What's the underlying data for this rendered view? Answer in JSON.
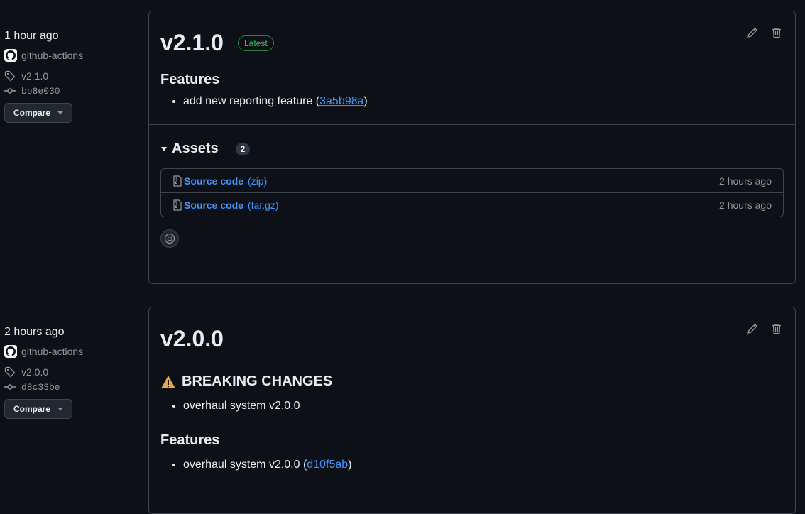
{
  "releases": [
    {
      "time": "1 hour ago",
      "author": "github-actions",
      "tag": "v2.1.0",
      "commit": "bb8e030",
      "compare_label": "Compare",
      "title": "v2.1.0",
      "badge": "Latest",
      "sections": [
        {
          "heading": "Features",
          "items": [
            {
              "text": "add new reporting feature (",
              "link": "3a5b98a",
              "suffix": ")"
            }
          ]
        }
      ],
      "assets": {
        "label": "Assets",
        "count": "2",
        "items": [
          {
            "name": "Source code",
            "ext": "(zip)",
            "time": "2 hours ago"
          },
          {
            "name": "Source code",
            "ext": "(tar.gz)",
            "time": "2 hours ago"
          }
        ]
      }
    },
    {
      "time": "2 hours ago",
      "author": "github-actions",
      "tag": "v2.0.0",
      "commit": "d8c33be",
      "compare_label": "Compare",
      "title": "v2.0.0",
      "sections": [
        {
          "heading": "BREAKING CHANGES",
          "icon": "warning-icon",
          "items": [
            {
              "text": "overhaul system v2.0.0"
            }
          ]
        },
        {
          "heading": "Features",
          "items": [
            {
              "text": "overhaul system v2.0.0 (",
              "link": "d10f5ab",
              "suffix": ")"
            }
          ]
        }
      ]
    }
  ]
}
